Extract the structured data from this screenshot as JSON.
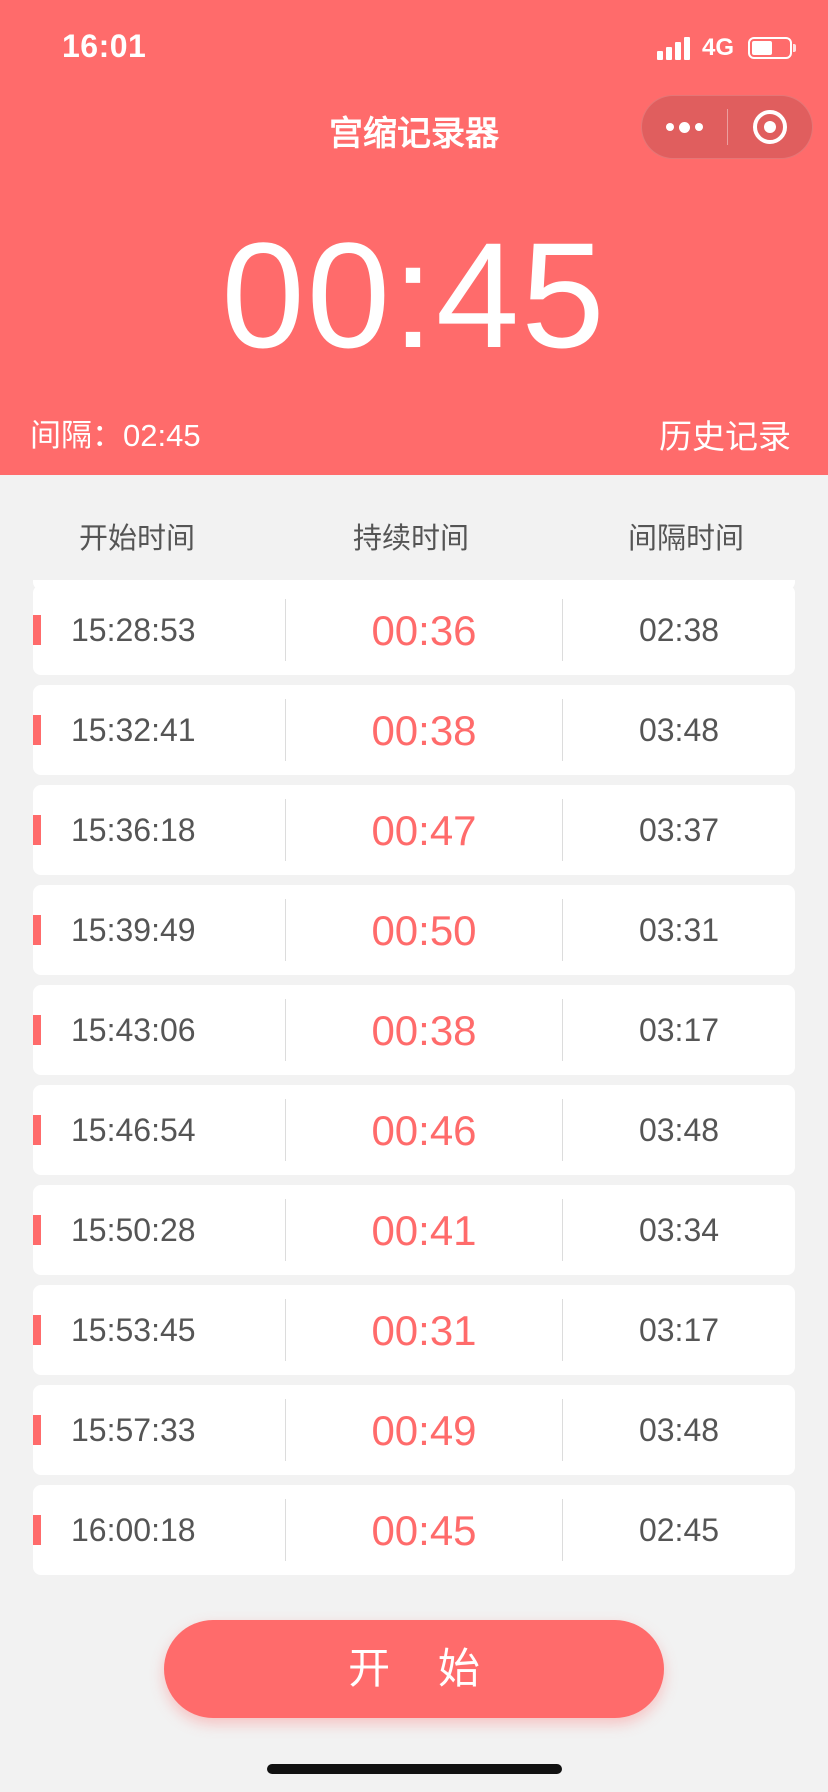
{
  "status_bar": {
    "time": "16:01",
    "network": "4G",
    "battery_level": 0.55
  },
  "header": {
    "title": "宫缩记录器",
    "current_duration": "00:45",
    "interval_summary": "间隔：02:45",
    "history_link": "历史记录"
  },
  "columns": {
    "start": "开始时间",
    "duration": "持续时间",
    "interval": "间隔时间"
  },
  "records": [
    {
      "start": "15:28:53",
      "duration": "00:36",
      "interval": "02:38"
    },
    {
      "start": "15:32:41",
      "duration": "00:38",
      "interval": "03:48"
    },
    {
      "start": "15:36:18",
      "duration": "00:47",
      "interval": "03:37"
    },
    {
      "start": "15:39:49",
      "duration": "00:50",
      "interval": "03:31"
    },
    {
      "start": "15:43:06",
      "duration": "00:38",
      "interval": "03:17"
    },
    {
      "start": "15:46:54",
      "duration": "00:46",
      "interval": "03:48"
    },
    {
      "start": "15:50:28",
      "duration": "00:41",
      "interval": "03:34"
    },
    {
      "start": "15:53:45",
      "duration": "00:31",
      "interval": "03:17"
    },
    {
      "start": "15:57:33",
      "duration": "00:49",
      "interval": "03:48"
    },
    {
      "start": "16:00:18",
      "duration": "00:45",
      "interval": "02:45"
    }
  ],
  "start_button": {
    "label": "开 始"
  },
  "colors": {
    "accent": "#ff6b6b",
    "background": "#f2f2f2"
  }
}
